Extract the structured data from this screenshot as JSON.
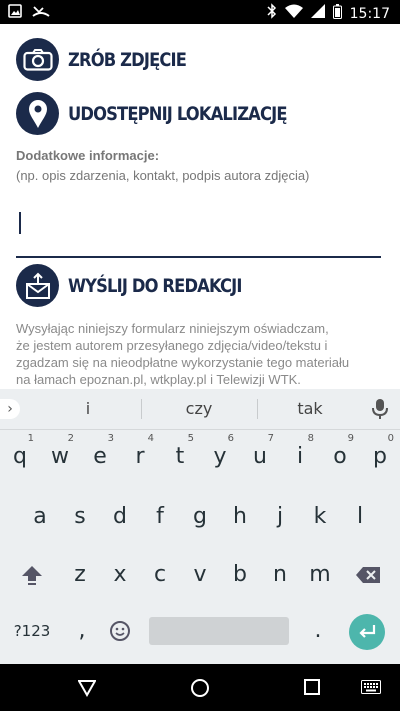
{
  "status_bar": {
    "time": "15:17",
    "left_icons": [
      "image-icon",
      "missed-call-icon"
    ],
    "right_icons": [
      "bluetooth-icon",
      "wifi-icon",
      "signal-icon",
      "battery-icon"
    ]
  },
  "actions": {
    "photo_label": "ZRÓB ZDJĘCIE",
    "location_label": "UDOSTĘPNIJ LOKALIZACJĘ",
    "send_label": "WYŚLIJ DO REDAKCJI"
  },
  "info": {
    "title": "Dodatkowe informacje:",
    "hint": "(np. opis zdarzenia, kontakt, podpis autora zdjęcia)",
    "value": ""
  },
  "disclaimer": {
    "line1": "Wysyłając niniejszy formularz niniejszym oświadczam,",
    "line2": "że jestem autorem przesyłanego zdjęcia/video/tekstu i",
    "line3": "zgadzam się na nieodpłatne wykorzystanie tego materiału",
    "line4": "na łamach epoznan.pl, wtkplay.pl i Telewizji WTK."
  },
  "keyboard": {
    "suggestions": [
      "i",
      "czy",
      "tak"
    ],
    "row1": [
      "q",
      "w",
      "e",
      "r",
      "t",
      "y",
      "u",
      "i",
      "o",
      "p"
    ],
    "row1_hints": [
      "1",
      "2",
      "3",
      "4",
      "5",
      "6",
      "7",
      "8",
      "9",
      "0"
    ],
    "row2": [
      "a",
      "s",
      "d",
      "f",
      "g",
      "h",
      "j",
      "k",
      "l"
    ],
    "row3": [
      "z",
      "x",
      "c",
      "v",
      "b",
      "n",
      "m"
    ],
    "symbols_label": "?123",
    "comma_label": ",",
    "period_label": ".",
    "accent_color": "#4db6ac"
  },
  "colors": {
    "brand_navy": "#1b2a4a",
    "status_bar": "#000000",
    "keyboard_bg": "#eceff1"
  }
}
